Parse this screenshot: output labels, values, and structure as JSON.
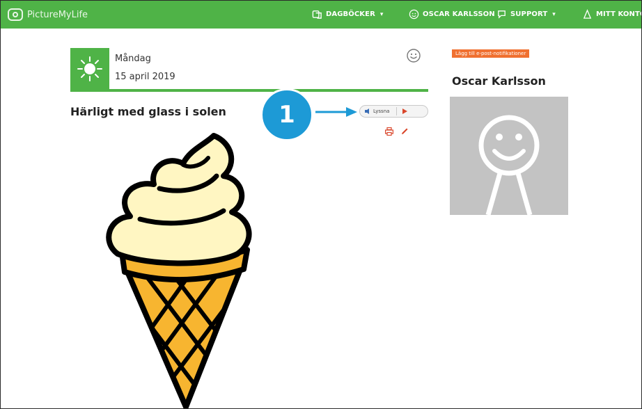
{
  "app": {
    "logo_text": "PictureMyLife"
  },
  "nav": {
    "diaries": "DAGBÖCKER",
    "user": "OSCAR KARLSSON",
    "support": "SUPPORT",
    "account": "MITT KONTO",
    "caret": "▾"
  },
  "entry": {
    "day": "Måndag",
    "date": "15 april 2019",
    "title": "Härligt med glass i solen",
    "listen_label": "Lyssna"
  },
  "callout": {
    "number": "1"
  },
  "sidebar": {
    "notification_button": "Lägg till e-post-notifikationer",
    "user_name": "Oscar Karlsson"
  },
  "colors": {
    "brand_green": "#4fb347",
    "callout_blue": "#1d9ad6",
    "accent_orange": "#f07030",
    "action_red": "#d9462b"
  },
  "icons": [
    "logo-icon",
    "diaries-icon",
    "user-icon",
    "support-icon",
    "account-icon",
    "sun-icon",
    "smiley-icon",
    "speaker-icon",
    "play-icon",
    "print-icon",
    "edit-icon",
    "ice-cream-cone-image",
    "avatar-smiley-icon"
  ]
}
